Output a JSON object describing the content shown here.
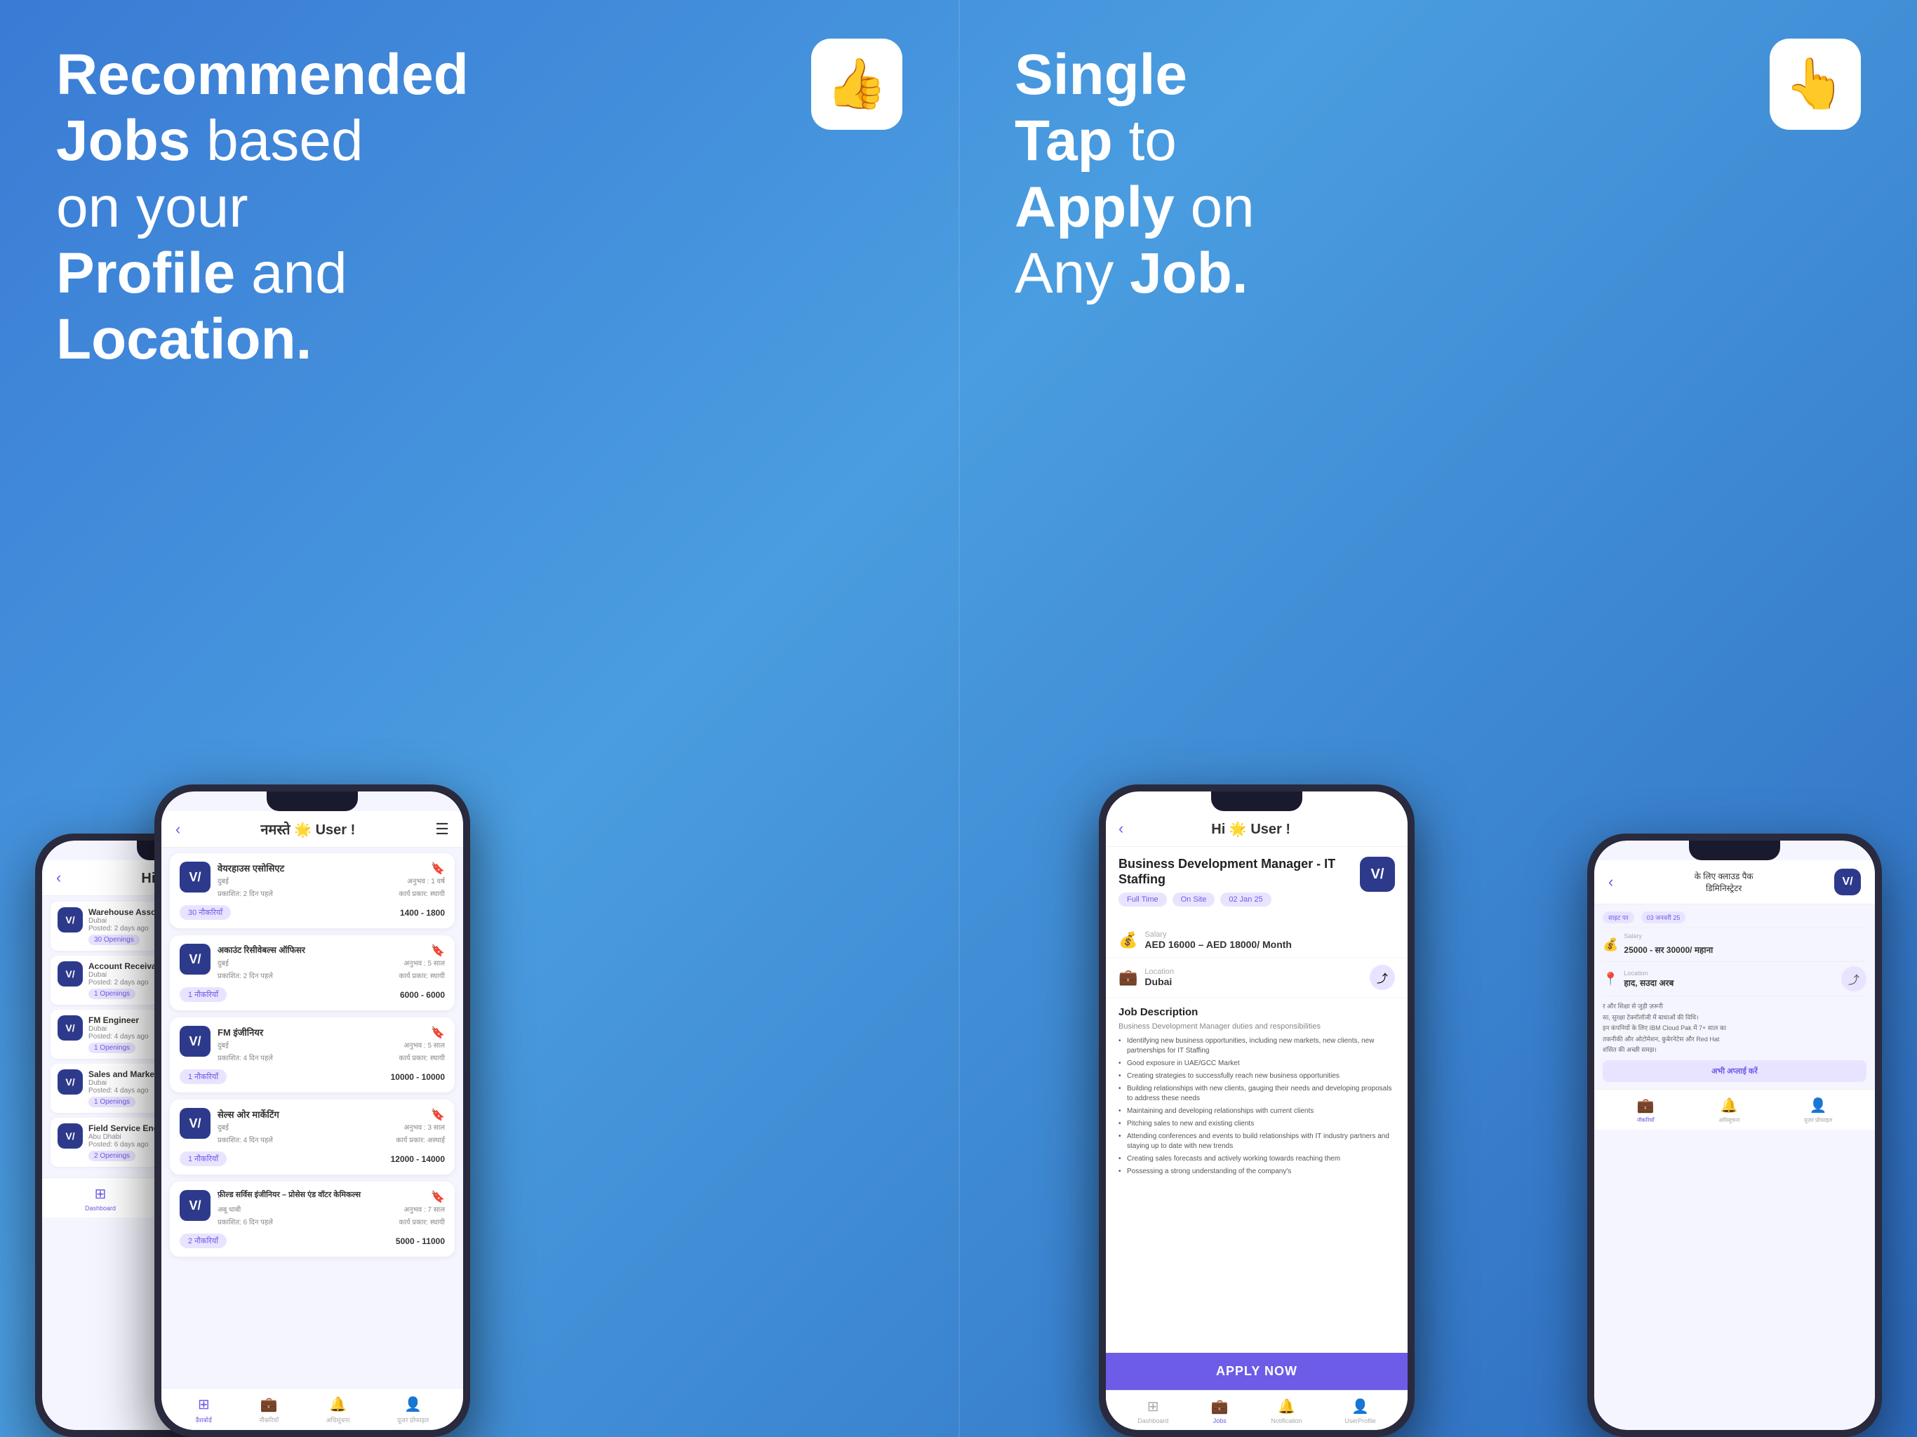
{
  "left": {
    "hero_line1": "Recommended",
    "hero_line2": "Jobs",
    "hero_text2": " based",
    "hero_line3": "on your",
    "hero_line4_strong": "Profile",
    "hero_line4_text": " and",
    "hero_line5": "Location.",
    "icon_emoji": "👍",
    "phones": {
      "back_screen": {
        "header_greeting": "Hi 🌟 Use",
        "jobs": [
          {
            "title": "Warehouse Asso...",
            "location": "Dubai",
            "posted": "Posted: 2 days ago",
            "openings": "30 Openings"
          },
          {
            "title": "Account Receival...",
            "location": "Dubai",
            "posted": "Posted: 2 days ago",
            "openings": "1 Openings"
          },
          {
            "title": "FM Engineer",
            "location": "Dubai",
            "posted": "Posted: 4 days ago",
            "openings": "1 Openings"
          },
          {
            "title": "Sales and Market...",
            "location": "Dubai",
            "posted": "Posted: 4 days ago",
            "openings": "1 Openings"
          },
          {
            "title": "Field Service Eng...",
            "location": "Abu Dhabi",
            "posted": "Posted: 6 days ago",
            "openings": "2 Openings"
          }
        ]
      },
      "front_screen": {
        "header_greeting": "नमस्ते 🌟 User !",
        "jobs": [
          {
            "title": "वेयरहाउस एसोसिएट",
            "location": "दुबई",
            "experience": "अनुभव : 1 वर्ष",
            "posted": "प्रकाशित: 2 दिन पहले",
            "work_type": "कार्य प्रकार: स्थायी",
            "openings": "30 नौकरियाँ",
            "salary": "1400 - 1800"
          },
          {
            "title": "अकाउंट रिसीवेबल्स ऑफिसर",
            "location": "दुबई",
            "experience": "अनुभव : 5 साल",
            "posted": "प्रकाशित: 2 दिन पहले",
            "work_type": "कार्य प्रकार: स्थायी",
            "openings": "1 नौकरियाँ",
            "salary": "6000 - 6000"
          },
          {
            "title": "FM इंजीनियर",
            "location": "दुबई",
            "experience": "अनुभव : 5 साल",
            "posted": "प्रकाशित: 4 दिन पहले",
            "work_type": "कार्य प्रकार: स्थायी",
            "openings": "1 नौकरियाँ",
            "salary": "10000 - 10000"
          },
          {
            "title": "सेल्स ओर मार्केटिंग",
            "location": "दुबई",
            "experience": "अनुभव : 3 साल",
            "posted": "प्रकाशित: 4 दिन पहले",
            "work_type": "कार्य प्रकार: अस्थाई",
            "openings": "1 नौकरियाँ",
            "salary": "12000 - 14000"
          },
          {
            "title": "फ़ील्ड सर्विस इंजीनियर – प्रोसेस एंड वॉटर केमिकल्स",
            "location": "अबू धाबी",
            "experience": "अनुभव : 7 साल",
            "posted": "प्रकाशित: 6 दिन पहले",
            "work_type": "कार्य प्रकार: स्थायी",
            "openings": "2 नौकरियाँ",
            "salary": "5000 - 11000"
          }
        ],
        "nav": [
          "डैशबोर्ड",
          "नौकरियाँ",
          "अधिसूचना",
          "यूजर प्रोफाइल"
        ]
      }
    }
  },
  "right": {
    "hero_line1": "Single",
    "hero_line2_strong": "Tap",
    "hero_line2_text": " to",
    "hero_line3_strong": "Apply",
    "hero_line3_text": " on",
    "hero_line4": "Any ",
    "hero_line4_strong": "Job.",
    "icon_emoji": "👆",
    "phones": {
      "back_screen": {
        "header": "के लिए क्लाउड पैक",
        "sub": "डिमिनिस्ट्रेटर",
        "tags": [
          "साइट पर",
          "03 जनवरी 25"
        ],
        "salary": "25000 - सर 30000/ महाना",
        "location": "हाद, सउदा अरब",
        "desc_line": "र और शिक्षा से जुड़ी ज़रूरी",
        "apply_label": "अभी अप्लाई करें",
        "nav": [
          "नौकरियाँ",
          "अधिसूचना",
          "यूज़र प्रोफाइल"
        ]
      },
      "front_screen": {
        "header_greeting": "Hi 🌟 User !",
        "job_title": "Business Development Manager - IT Staffing",
        "tags": [
          "Full Time",
          "On Site",
          "02 Jan 25"
        ],
        "salary_label": "Salary",
        "salary_value": "AED 16000 – AED 18000/ Month",
        "location_label": "Location",
        "location_value": "Dubai",
        "desc_title": "Job Description",
        "desc_subtitle": "Business Development Manager duties and responsibilities",
        "bullets": [
          "Identifying new business opportunities, including new markets, new clients, new partnerships for IT Staffing",
          "Good exposure in UAE/GCC Market",
          "Creating strategies to successfully reach new business opportunities",
          "Building relationships with new clients, gauging their needs and developing proposals to address these needs",
          "Maintaining and developing relationships with current clients",
          "Pitching sales to new and existing clients",
          "Attending conferences and events to build relationships with IT industry partners and staying up to date with new trends",
          "Creating sales forecasts and actively working towards reaching them",
          "Possessing a strong understanding of the company's"
        ],
        "apply_now_label": "APPLY NOW",
        "nav": [
          "Dashboard",
          "Jobs",
          "Notification",
          "UserProfile"
        ]
      }
    }
  }
}
